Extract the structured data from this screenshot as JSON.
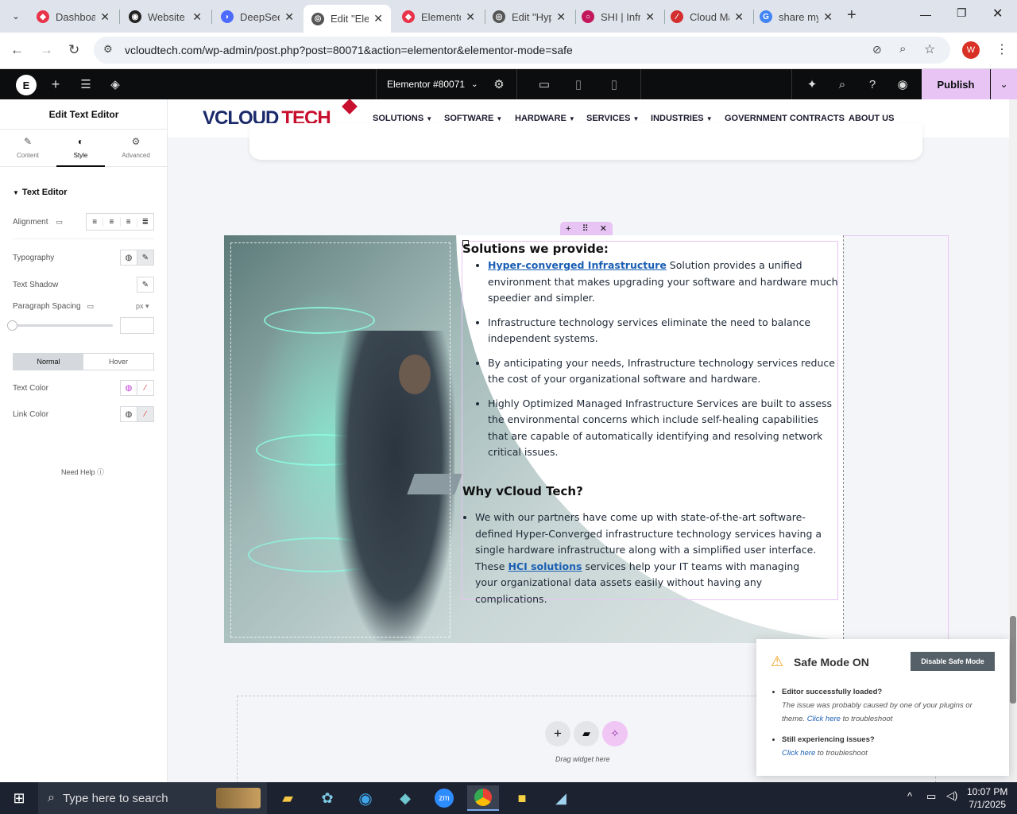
{
  "browser": {
    "tabs": [
      {
        "label": "Dashboard",
        "color": "#e8334a",
        "glyph": "◆"
      },
      {
        "label": "Website",
        "color": "#222",
        "glyph": "◉"
      },
      {
        "label": "DeepSeek",
        "color": "#4d6bfe",
        "glyph": "◗"
      },
      {
        "label": "Edit \"Elementor",
        "color": "#555",
        "glyph": "◎"
      },
      {
        "label": "Elementor",
        "color": "#e8334a",
        "glyph": "◆"
      },
      {
        "label": "Edit \"Hyper",
        "color": "#555",
        "glyph": "◎"
      },
      {
        "label": "SHI | Infra",
        "color": "#c2185b",
        "glyph": "○"
      },
      {
        "label": "Cloud Man",
        "color": "#d32f2f",
        "glyph": "⁄"
      },
      {
        "label": "share my",
        "color": "#4285f4",
        "glyph": "G"
      }
    ],
    "url": "vcloudtech.com/wp-admin/post.php?post=80071&action=elementor&elementor-mode=safe",
    "profile_initial": "W"
  },
  "editor_top": {
    "doc_title": "Elementor #80071",
    "publish": "Publish"
  },
  "panel": {
    "title": "Edit Text Editor",
    "tabs": [
      "Content",
      "Style",
      "Advanced"
    ],
    "section": "Text Editor",
    "alignment": "Alignment",
    "typography": "Typography",
    "text_shadow": "Text Shadow",
    "paragraph_spacing": "Paragraph Spacing",
    "unit": "px",
    "state_tabs": [
      "Normal",
      "Hover"
    ],
    "text_color": "Text Color",
    "link_color": "Link Color",
    "need_help": "Need Help"
  },
  "site": {
    "logo_a": "VCLOUD",
    "logo_b": "TECH",
    "nav": [
      "SOLUTIONS",
      "SOFTWARE",
      "HARDWARE",
      "SERVICES",
      "INDUSTRIES",
      "GOVERNMENT CONTRACTS",
      "ABOUT US"
    ]
  },
  "content": {
    "heading1": "Solutions we provide:",
    "b1_link": "Hyper-converged Infrastructure",
    "b1_rest": " Solution provides a unified environment that makes upgrading your software and hardware much speedier and simpler.",
    "b2": "Infrastructure technology services eliminate the need to balance independent systems.",
    "b3": "By anticipating your needs, Infrastructure technology services reduce the cost of your organizational software and hardware.",
    "b4": "Highly Optimized Managed Infrastructure Services are built to assess the environmental concerns which include self-healing capabilities that are capable of automatically identifying and resolving network critical issues.",
    "heading2": "Why vCloud Tech?",
    "w1_a": "We with our partners have come up with state-of-the-art software-defined Hyper-Converged infrastructure technology services having a single hardware infrastructure along with a simplified user interface. These ",
    "w1_link": "HCI solutions",
    "w1_b": " services help your IT teams with managing your organizational data assets easily without having any complications."
  },
  "dropzone": {
    "label": "Drag widget here"
  },
  "safemode": {
    "title": "Safe Mode ON",
    "button": "Disable Safe Mode",
    "q1": "Editor successfully loaded?",
    "a1": "The issue was probably caused by one of your plugins or theme.",
    "link": "Click here",
    "a1_end": " to troubleshoot",
    "q2": "Still experiencing issues?",
    "a2_end": " to troubleshoot"
  },
  "taskbar": {
    "search": "Type here to search",
    "time": "10:07 PM",
    "date": "7/1/2025"
  },
  "colors": {
    "accent": "#e8c4f5",
    "elementor": "#92003b",
    "link": "#1a5fb4",
    "brand_red": "#c8102e"
  }
}
